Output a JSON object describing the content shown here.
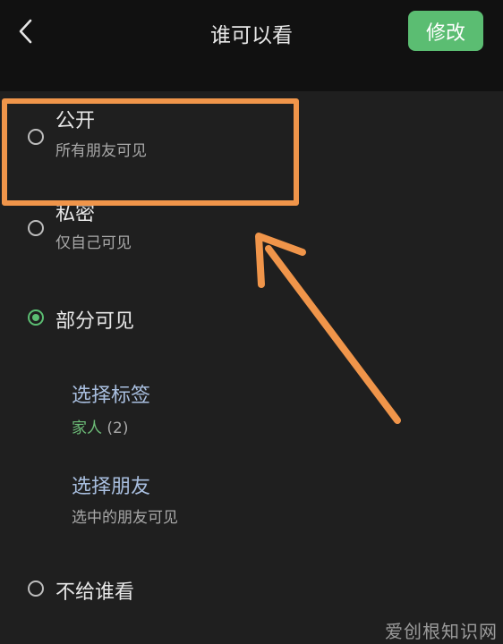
{
  "header": {
    "back_icon": "chevron-left-icon",
    "title": "谁可以看",
    "edit_label": "修改",
    "edit_color": "#5bbd72"
  },
  "options": {
    "public": {
      "title": "公开",
      "subtitle": "所有朋友可见",
      "selected": false
    },
    "private": {
      "title": "私密",
      "subtitle": "仅自己可见",
      "selected": false
    },
    "partial": {
      "title": "部分可见",
      "selected": true,
      "select_tags": {
        "title": "选择标签",
        "tag_name": "家人",
        "tag_count": "(2)"
      },
      "select_friends": {
        "title": "选择朋友",
        "subtitle": "选中的朋友可见"
      }
    },
    "exclude": {
      "title": "不给谁看",
      "selected": false
    }
  },
  "annotation": {
    "color": "#f0954a"
  },
  "watermark": "爱创根知识网"
}
